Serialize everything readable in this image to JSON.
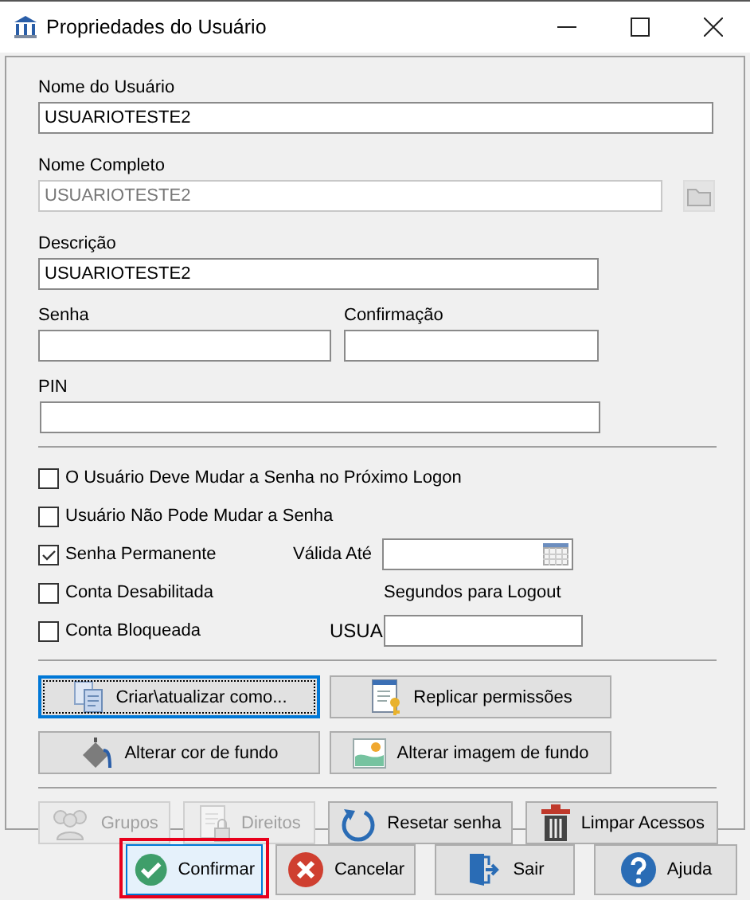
{
  "window": {
    "title": "Propriedades do Usuário"
  },
  "user_name": {
    "label": "Nome do Usuário",
    "value": "USUARIOTESTE2"
  },
  "full_name": {
    "label": "Nome Completo",
    "value": "USUARIOTESTE2",
    "disabled": true
  },
  "description": {
    "label": "Descrição",
    "value": "USUARIOTESTE2"
  },
  "password": {
    "label": "Senha"
  },
  "confirmation": {
    "label": "Confirmação"
  },
  "pin": {
    "label": "PIN"
  },
  "checkboxes": [
    {
      "label": "O Usuário Deve Mudar a Senha no Próximo Logon",
      "checked": false
    },
    {
      "label": "Usuário Não Pode Mudar a Senha",
      "checked": false
    },
    {
      "label": "Senha Permanente",
      "checked": true
    },
    {
      "label": "Conta Desabilitada",
      "checked": false
    },
    {
      "label": "Conta Bloqueada",
      "checked": false
    }
  ],
  "valid_until": {
    "label": "Válida Até"
  },
  "logout_seconds": {
    "label": "Segundos para Logout",
    "partial_text": "USUA"
  },
  "action_buttons": [
    {
      "label": "Criar\\atualizar como...",
      "focused": true
    },
    {
      "label": "Replicar permissões",
      "focused": false
    },
    {
      "label": "Alterar cor de fundo",
      "focused": false
    },
    {
      "label": "Alterar imagem de fundo",
      "focused": false
    }
  ],
  "tool_buttons": [
    {
      "label": "Grupos",
      "disabled": true
    },
    {
      "label": "Direitos",
      "disabled": true
    },
    {
      "label": "Resetar senha",
      "disabled": false
    },
    {
      "label": "Limpar Acessos",
      "disabled": false
    }
  ],
  "footer_buttons": [
    {
      "label": "Confirmar",
      "highlighted": true
    },
    {
      "label": "Cancelar",
      "highlighted": false
    },
    {
      "label": "Sair",
      "highlighted": false
    },
    {
      "label": "Ajuda",
      "highlighted": false
    }
  ]
}
